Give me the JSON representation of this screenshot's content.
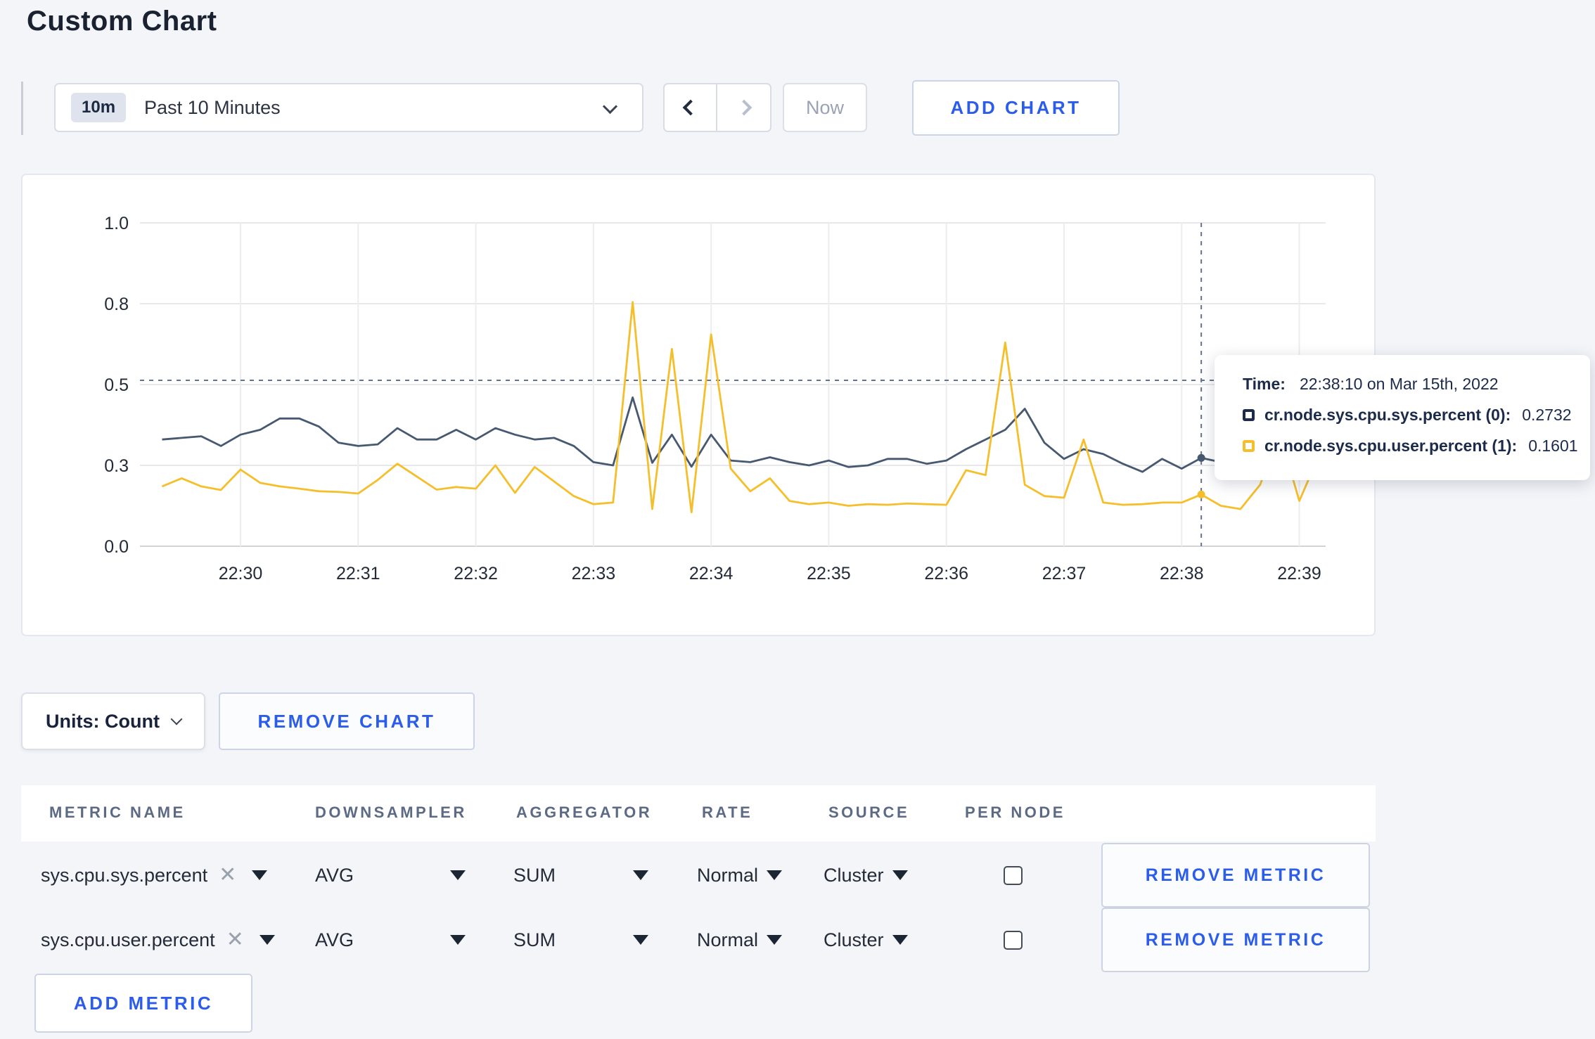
{
  "title": "Custom Chart",
  "time_selector": {
    "badge": "10m",
    "label": "Past 10 Minutes",
    "now": "Now"
  },
  "buttons": {
    "add_chart": "ADD CHART",
    "remove_chart": "REMOVE CHART",
    "add_metric": "ADD METRIC",
    "remove_metric": "REMOVE METRIC"
  },
  "units": {
    "label": "Units: Count"
  },
  "tooltip": {
    "time_label": "Time:",
    "time_value": "22:38:10 on Mar 15th, 2022",
    "series": [
      {
        "label": "cr.node.sys.cpu.sys.percent (0):",
        "value": "0.2732",
        "color": "#1c2b4a"
      },
      {
        "label": "cr.node.sys.cpu.user.percent (1):",
        "value": "0.1601",
        "color": "#f5bf2c"
      }
    ]
  },
  "metrics": {
    "headers": [
      "METRIC NAME",
      "DOWNSAMPLER",
      "AGGREGATOR",
      "RATE",
      "SOURCE",
      "PER NODE"
    ],
    "rows": [
      {
        "name": "sys.cpu.sys.percent",
        "downsampler": "AVG",
        "aggregator": "SUM",
        "rate": "Normal",
        "source": "Cluster",
        "per_node_checked": false
      },
      {
        "name": "sys.cpu.user.percent",
        "downsampler": "AVG",
        "aggregator": "SUM",
        "rate": "Normal",
        "source": "Cluster",
        "per_node_checked": false
      }
    ]
  },
  "chart_data": {
    "type": "line",
    "title": "",
    "xlabel": "",
    "ylabel": "",
    "x_start": "22:29:20",
    "x_step_seconds": 10,
    "ylim": [
      0,
      1
    ],
    "grid": true,
    "legend_position": "tooltip-overlay",
    "y_ticks": [
      {
        "label": "1.0",
        "value": 1.0
      },
      {
        "label": "0.8",
        "value": 0.75
      },
      {
        "label": "0.5",
        "value": 0.5
      },
      {
        "label": "0.3",
        "value": 0.25
      },
      {
        "label": "0.0",
        "value": 0.0
      }
    ],
    "x_ticks": [
      {
        "label": "22:30",
        "index": 4
      },
      {
        "label": "22:31",
        "index": 10
      },
      {
        "label": "22:32",
        "index": 16
      },
      {
        "label": "22:33",
        "index": 22
      },
      {
        "label": "22:34",
        "index": 28
      },
      {
        "label": "22:35",
        "index": 34
      },
      {
        "label": "22:36",
        "index": 40
      },
      {
        "label": "22:37",
        "index": 46
      },
      {
        "label": "22:38",
        "index": 52
      },
      {
        "label": "22:39",
        "index": 58
      }
    ],
    "series": [
      {
        "name": "cr.node.sys.cpu.sys.percent (0)",
        "color": "#475970",
        "values": [
          0.33,
          0.335,
          0.34,
          0.31,
          0.345,
          0.36,
          0.395,
          0.395,
          0.37,
          0.32,
          0.31,
          0.315,
          0.365,
          0.33,
          0.33,
          0.36,
          0.33,
          0.365,
          0.345,
          0.33,
          0.335,
          0.31,
          0.26,
          0.25,
          0.46,
          0.258,
          0.345,
          0.246,
          0.345,
          0.265,
          0.26,
          0.275,
          0.26,
          0.25,
          0.265,
          0.245,
          0.25,
          0.27,
          0.27,
          0.255,
          0.265,
          0.3,
          0.33,
          0.36,
          0.425,
          0.32,
          0.27,
          0.3,
          0.285,
          0.255,
          0.23,
          0.27,
          0.24,
          0.273,
          0.26,
          0.245,
          0.255,
          0.26
        ]
      },
      {
        "name": "cr.node.sys.cpu.user.percent (1)",
        "color": "#f5bf2c",
        "values": [
          0.185,
          0.21,
          0.185,
          0.174,
          0.237,
          0.196,
          0.185,
          0.178,
          0.17,
          0.168,
          0.163,
          0.205,
          0.255,
          0.215,
          0.175,
          0.183,
          0.178,
          0.25,
          0.165,
          0.245,
          0.2,
          0.155,
          0.13,
          0.135,
          0.755,
          0.115,
          0.61,
          0.105,
          0.655,
          0.24,
          0.17,
          0.21,
          0.14,
          0.13,
          0.135,
          0.125,
          0.13,
          0.128,
          0.132,
          0.13,
          0.128,
          0.235,
          0.22,
          0.63,
          0.19,
          0.155,
          0.15,
          0.33,
          0.135,
          0.128,
          0.13,
          0.135,
          0.135,
          0.16,
          0.125,
          0.115,
          0.19,
          0.35,
          0.14,
          0.28
        ]
      }
    ],
    "crosshair": {
      "index": 53,
      "time": "22:38:10",
      "h_value": 0.513
    },
    "hover_points": [
      {
        "series": 0,
        "value": 0.2732
      },
      {
        "series": 1,
        "value": 0.1601
      }
    ],
    "style": {
      "grid": "#e8e8ec",
      "grid_zero": "#d4d4d8",
      "vgrid": "#ededf0",
      "crosshair": "#64748f",
      "tick_color": "#242b38"
    }
  }
}
